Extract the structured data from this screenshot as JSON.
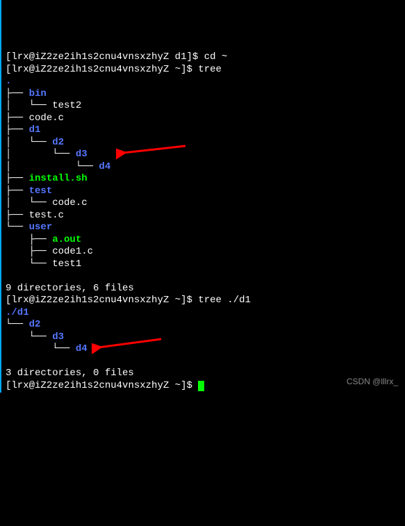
{
  "prompt1": {
    "bracket_open": "[",
    "user": "lrx",
    "at": "@",
    "host": "iZ2ze2ih1s2cnu4vnsxzhyZ",
    "space": " ",
    "path": "d1",
    "bracket_close": "]",
    "dollar": "$ ",
    "command": "cd ~"
  },
  "prompt2": {
    "bracket_open": "[",
    "user": "lrx",
    "at": "@",
    "host": "iZ2ze2ih1s2cnu4vnsxzhyZ",
    "space": " ",
    "path": "~",
    "bracket_close": "]",
    "dollar": "$ ",
    "command": "tree"
  },
  "tree1": {
    "root": ".",
    "l1": "├── ",
    "bin": "bin",
    "l2": "│   └── ",
    "test2": "test2",
    "l3": "├── ",
    "codec": "code.c",
    "l4": "├── ",
    "d1": "d1",
    "l5": "│   └── ",
    "d2": "d2",
    "l6": "│       └── ",
    "d3": "d3",
    "l7": "│           └── ",
    "d4": "d4",
    "l8": "├── ",
    "install": "install.sh",
    "l9": "├── ",
    "test": "test",
    "l10": "│   └── ",
    "testcodec": "code.c",
    "l11": "├── ",
    "testc": "test.c",
    "l12": "└── ",
    "user": "user",
    "l13": "    ├── ",
    "aout": "a.out",
    "l14": "    ├── ",
    "code1c": "code1.c",
    "l15": "    └── ",
    "test1": "test1"
  },
  "summary1": "9 directories, 6 files",
  "prompt3": {
    "bracket_open": "[",
    "user": "lrx",
    "at": "@",
    "host": "iZ2ze2ih1s2cnu4vnsxzhyZ",
    "space": " ",
    "path": "~",
    "bracket_close": "]",
    "dollar": "$ ",
    "command": "tree ./d1"
  },
  "tree2": {
    "root": "./d1",
    "l1": "└── ",
    "d2": "d2",
    "l2": "    └── ",
    "d3": "d3",
    "l3": "        └── ",
    "d4": "d4"
  },
  "summary2": "3 directories, 0 files",
  "prompt4": {
    "bracket_open": "[",
    "user": "lrx",
    "at": "@",
    "host": "iZ2ze2ih1s2cnu4vnsxzhyZ",
    "space": " ",
    "path": "~",
    "bracket_close": "]",
    "dollar": "$ "
  },
  "watermark": "CSDN @lllrx_"
}
